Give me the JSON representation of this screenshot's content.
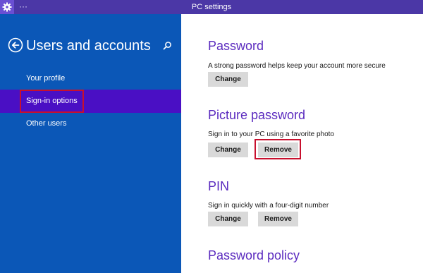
{
  "window": {
    "title": "PC settings",
    "title_dots": "···",
    "app_icon": "gear-icon"
  },
  "sidebar": {
    "back_icon": "back-arrow-icon",
    "title": "Users and accounts",
    "search_icon": "search-icon",
    "selected_index": 1,
    "items": [
      {
        "label": "Your profile"
      },
      {
        "label": "Sign-in options"
      },
      {
        "label": "Other users"
      }
    ]
  },
  "main": {
    "password": {
      "heading": "Password",
      "description": "A strong password helps keep your account more secure",
      "change_label": "Change"
    },
    "picture_password": {
      "heading": "Picture password",
      "description": "Sign in to your PC using a favorite photo",
      "change_label": "Change",
      "remove_label": "Remove"
    },
    "pin": {
      "heading": "PIN",
      "description": "Sign in quickly with a four-digit number",
      "change_label": "Change",
      "remove_label": "Remove"
    },
    "password_policy": {
      "heading": "Password policy"
    }
  },
  "colors": {
    "title_bar": "#4b37a6",
    "sidebar_bg": "#0b57b7",
    "sidebar_selected": "#4a0fc4",
    "heading_accent": "#5b2bbf",
    "button_bg": "#d9d9d9",
    "highlight": "#c8102e"
  }
}
